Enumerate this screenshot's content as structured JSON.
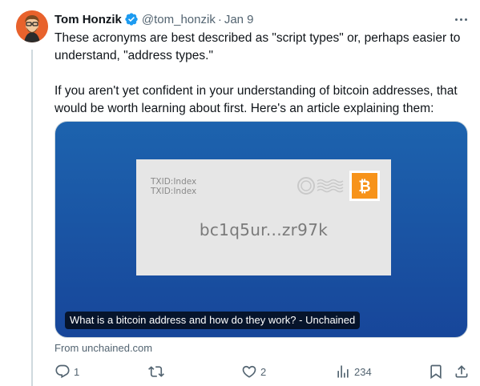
{
  "tweet": {
    "author_name": "Tom Honzik",
    "handle": "@tom_honzik",
    "separator": "·",
    "date": "Jan 9",
    "paragraphs": [
      "These acronyms are best described as \"script types\" or, perhaps easier to understand, \"address types.\"",
      "If you aren't yet confident in your understanding of bitcoin addresses, that would be worth learning about first. Here's an article explaining them:"
    ]
  },
  "card": {
    "txid_line1": "TXID:Index",
    "txid_line2": "TXID:Index",
    "address": "bc1q5ur...zr97k",
    "caption": "What is a bitcoin address and how do they work? - Unchained",
    "source": "From unchained.com"
  },
  "actions": {
    "reply_count": "1",
    "like_count": "2",
    "view_count": "234"
  },
  "icons": {
    "verified": "verified-badge-icon",
    "more": "more-options-icon",
    "reply": "reply-icon",
    "retweet": "retweet-icon",
    "like": "heart-icon",
    "views": "views-chart-icon",
    "bookmark": "bookmark-icon",
    "share": "share-icon",
    "stamp": "bitcoin-icon"
  },
  "colors": {
    "verified_blue": "#1d9bf0",
    "card_blue": "#1d63ae",
    "bitcoin_orange": "#f7931a",
    "secondary_text": "#536471"
  }
}
